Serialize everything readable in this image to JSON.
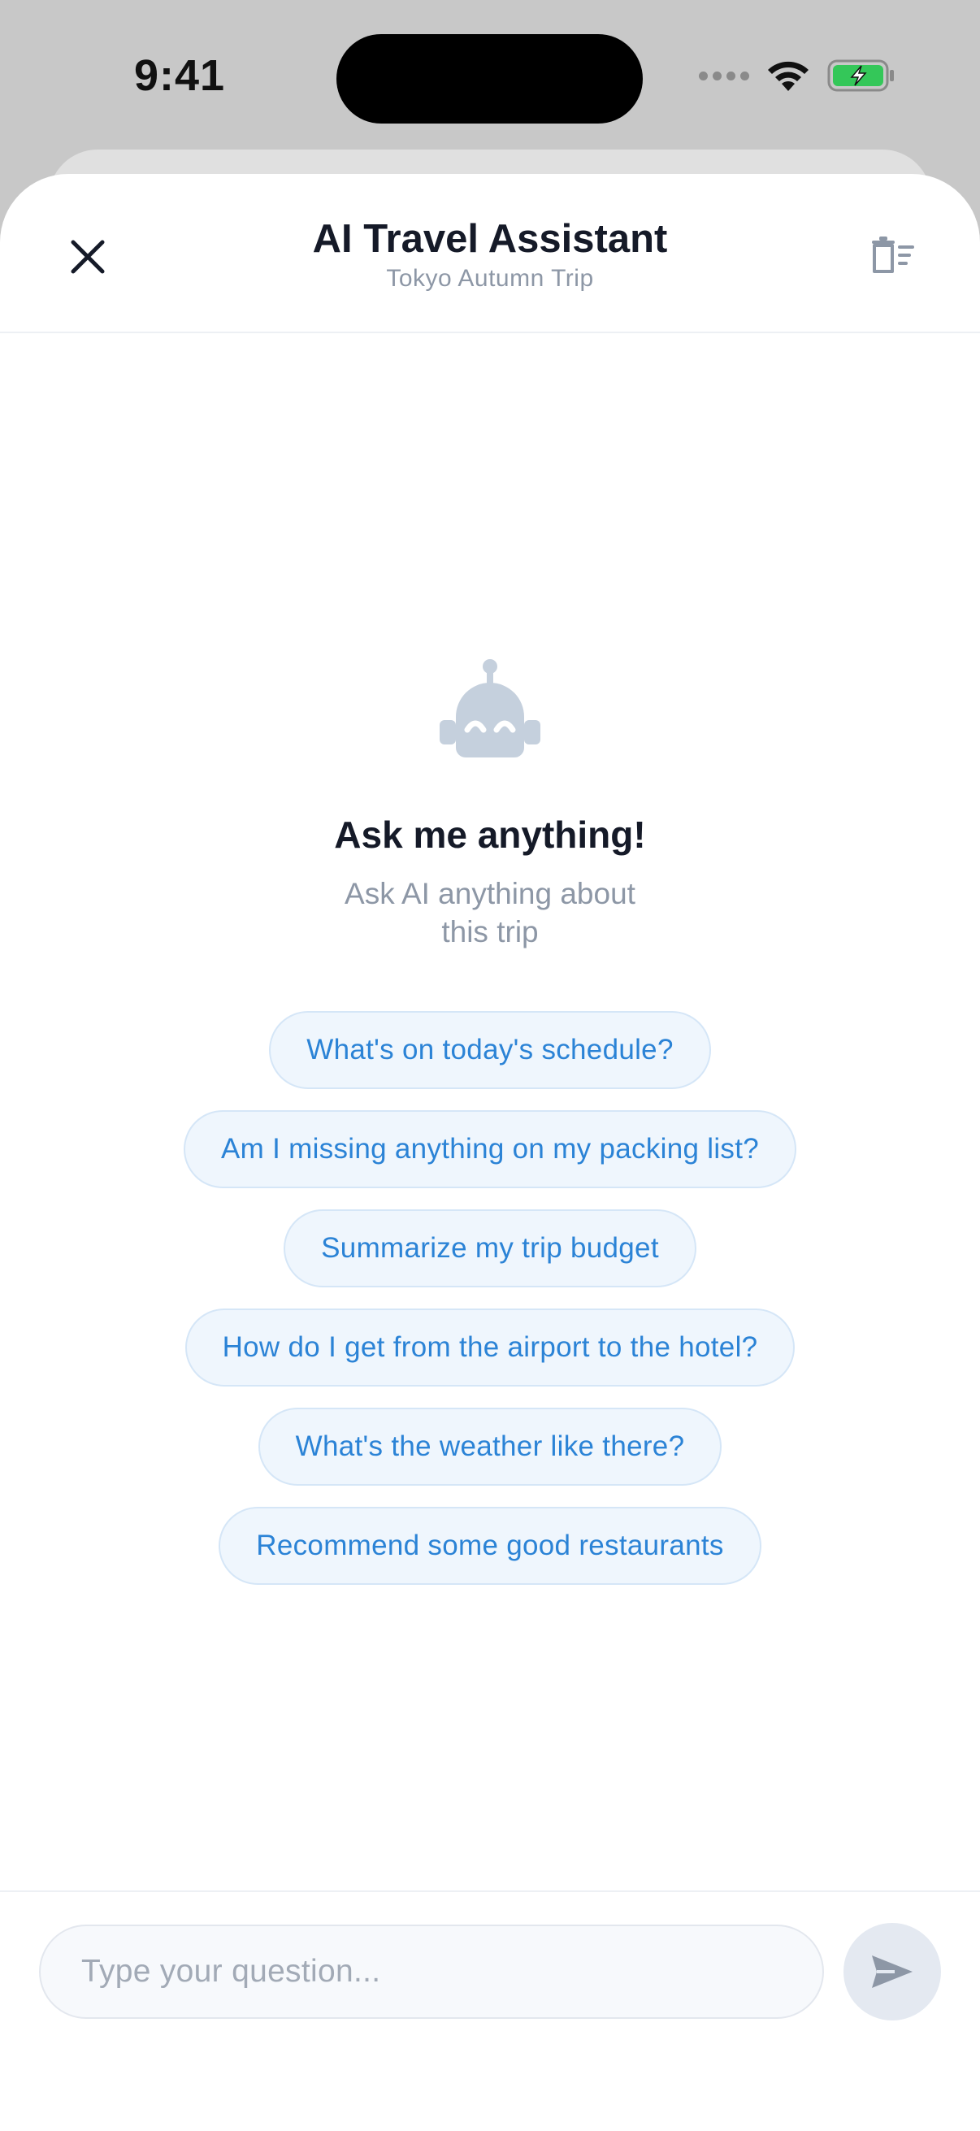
{
  "status_bar": {
    "time": "9:41"
  },
  "header": {
    "title": "AI Travel Assistant",
    "subtitle": "Tokyo Autumn Trip",
    "close_icon": "close-icon",
    "clear_icon": "clear-chat-icon"
  },
  "empty_state": {
    "icon": "robot-icon",
    "title": "Ask me anything!",
    "description": "Ask AI anything about this trip"
  },
  "suggestions": [
    "What's on today's schedule?",
    "Am I missing anything on my packing list?",
    "Summarize my trip budget",
    "How do I get from the airport to the hotel?",
    "What's the weather like there?",
    "Recommend some good restaurants"
  ],
  "input": {
    "placeholder": "Type your question...",
    "send_icon": "send-icon"
  },
  "colors": {
    "accent": "#2b83d6",
    "chip_bg": "#eff6fd",
    "title": "#151a28",
    "muted": "#8d97a6",
    "battery": "#34c759"
  }
}
